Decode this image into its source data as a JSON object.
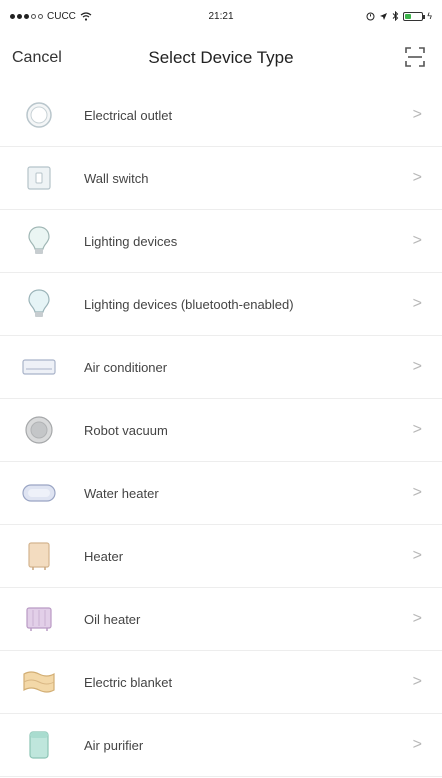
{
  "status_bar": {
    "carrier": "CUCC",
    "time": "21:21"
  },
  "nav": {
    "cancel_label": "Cancel",
    "title": "Select Device Type",
    "scan_icon": "scan-icon"
  },
  "devices": [
    {
      "label": "Electrical outlet",
      "icon": "electrical-outlet-icon"
    },
    {
      "label": "Wall switch",
      "icon": "wall-switch-icon"
    },
    {
      "label": "Lighting devices",
      "icon": "light-bulb-icon"
    },
    {
      "label": "Lighting devices (bluetooth-enabled)",
      "icon": "bluetooth-bulb-icon"
    },
    {
      "label": "Air conditioner",
      "icon": "air-conditioner-icon"
    },
    {
      "label": "Robot vacuum",
      "icon": "robot-vacuum-icon"
    },
    {
      "label": "Water heater",
      "icon": "water-heater-icon"
    },
    {
      "label": "Heater",
      "icon": "heater-icon"
    },
    {
      "label": "Oil heater",
      "icon": "oil-heater-icon"
    },
    {
      "label": "Electric blanket",
      "icon": "electric-blanket-icon"
    },
    {
      "label": "Air purifier",
      "icon": "air-purifier-icon"
    }
  ],
  "chevron_glyph": ">",
  "colors": {
    "divider": "#ededed",
    "chevron": "#b8b8b8",
    "battery": "#3cb34a"
  }
}
